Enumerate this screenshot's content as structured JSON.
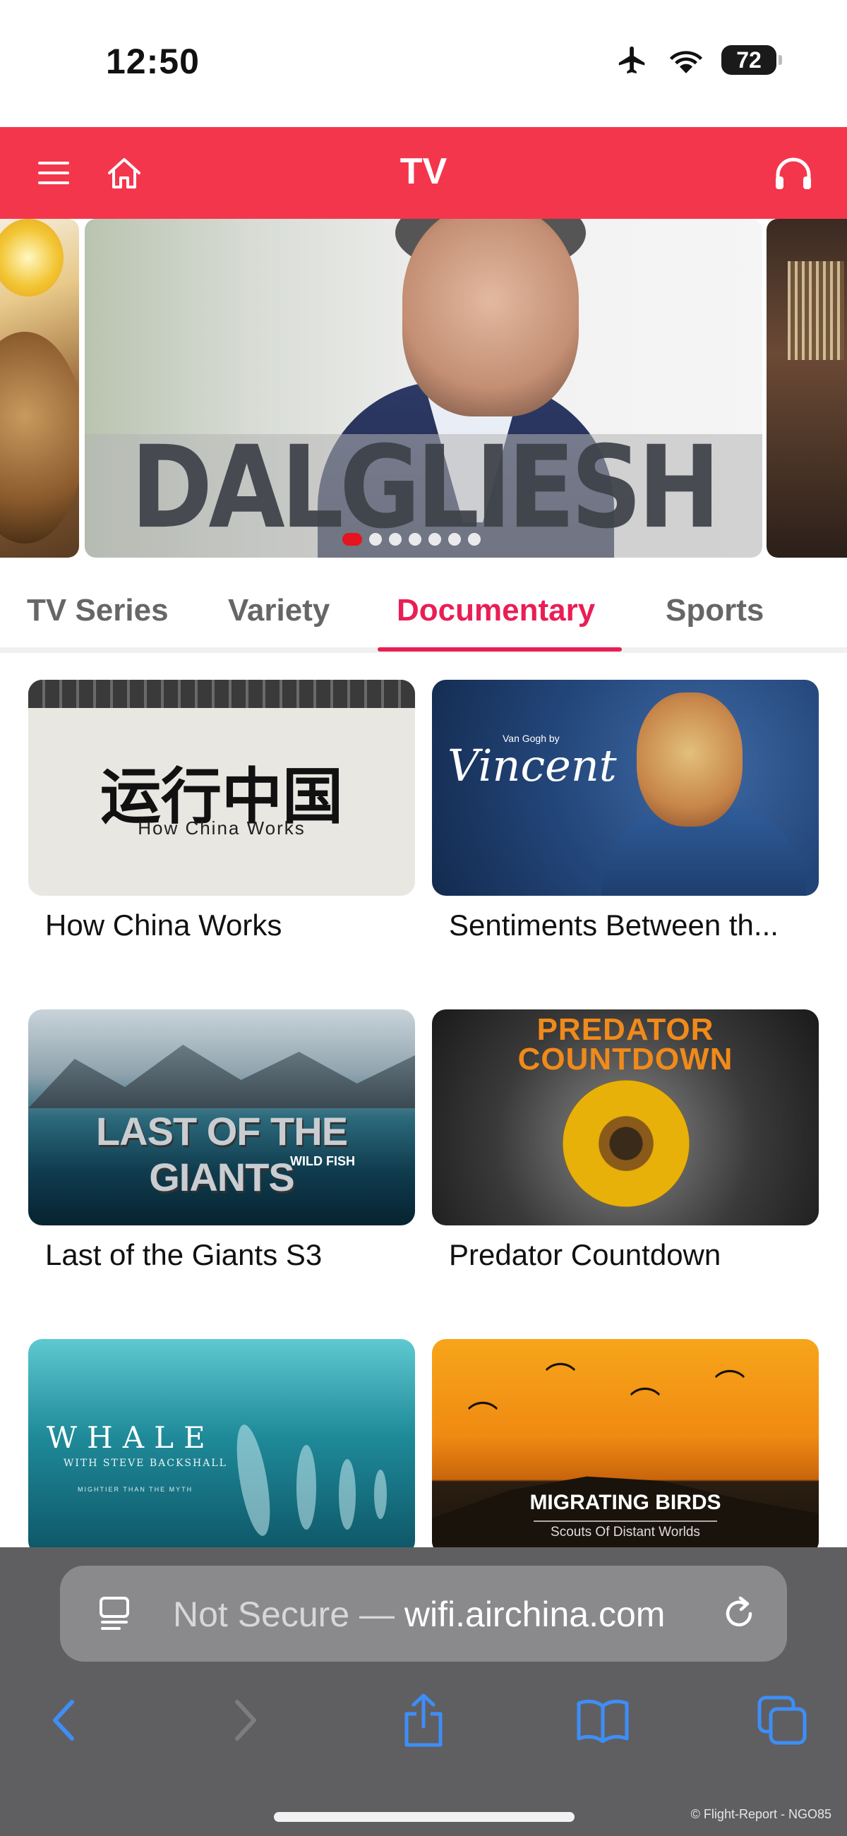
{
  "status_bar": {
    "time": "12:50",
    "battery": "72",
    "icons": [
      "airplane-icon",
      "wifi-icon",
      "battery-icon"
    ]
  },
  "header": {
    "title": "TV",
    "icons": [
      "menu-icon",
      "home-icon",
      "headphones-icon"
    ]
  },
  "carousel": {
    "title": "DALGLIESH",
    "dots_total": 7,
    "active_dot": 0
  },
  "tabs": [
    {
      "label": "TV Series",
      "active": false
    },
    {
      "label": "Variety",
      "active": false
    },
    {
      "label": "Documentary",
      "active": true
    },
    {
      "label": "Sports",
      "active": false
    }
  ],
  "cards": [
    {
      "title": "How China Works",
      "thumb_text": "运行中国",
      "thumb_subtext": "How China Works"
    },
    {
      "title": "Sentiments Between th...",
      "thumb_text": "Vincent",
      "thumb_subtext": "Van Gogh by"
    },
    {
      "title": "Last of the Giants S3",
      "thumb_text": "LAST OF THE GIANTS",
      "thumb_subtext": "WILD FISH"
    },
    {
      "title": "Predator Countdown",
      "thumb_text": "PREDATOR COUNTDOWN",
      "thumb_subtext": ""
    },
    {
      "title": "",
      "thumb_text": "WHALE",
      "thumb_subtext": "WITH STEVE BACKSHALL",
      "thumb_tag": "MIGHTIER THAN THE MYTH"
    },
    {
      "title": "",
      "thumb_text": "MIGRATING BIRDS",
      "thumb_subtext": "Scouts Of Distant Worlds"
    }
  ],
  "safari": {
    "url_prefix": "Not Secure — ",
    "url_domain": "wifi.airchina.com",
    "toolbar_icons": [
      "back-icon",
      "forward-icon",
      "share-icon",
      "bookmarks-icon",
      "tabs-icon"
    ]
  },
  "watermark": "© Flight-Report - NGO85",
  "colors": {
    "brand": "#f4364c",
    "tab_active": "#e91e55",
    "link_blue": "#3e8ef7"
  }
}
